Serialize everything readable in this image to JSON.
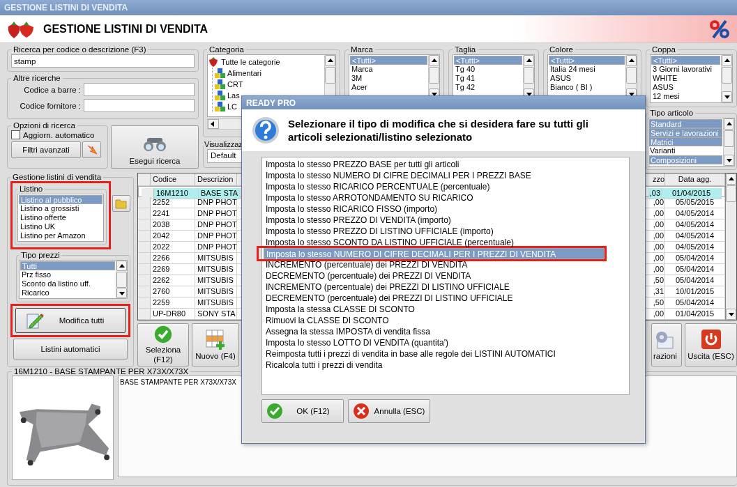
{
  "window": {
    "title": "GESTIONE LISTINI DI VENDITA"
  },
  "header": {
    "title": "GESTIONE LISTINI DI VENDITA"
  },
  "search": {
    "label": "Ricerca per codice o descrizione (F3)",
    "value": "stamp"
  },
  "other_searches": {
    "label": "Altre ricerche",
    "fields": [
      {
        "label": "Codice a barre :"
      },
      {
        "label": "Codice fornitore :"
      }
    ]
  },
  "search_options": {
    "label": "Opzioni di ricerca",
    "auto_update": {
      "label": "Aggiorn. automatico",
      "checked": false
    },
    "advanced_filters": "Filtri avanzati"
  },
  "run_search": "Esegui ricerca",
  "category": {
    "label": "Categoria",
    "tree": [
      {
        "label": "Tutte le categorie",
        "children": [
          {
            "label": "Alimentari"
          },
          {
            "label": "CRT"
          },
          {
            "label": "Las"
          },
          {
            "label": "LC"
          }
        ]
      }
    ]
  },
  "view": {
    "label": "Visualizzaz",
    "value": "Default"
  },
  "filters": [
    {
      "label": "Marca",
      "items": [
        {
          "label": "<Tutti>",
          "selected": true
        },
        {
          "label": "Marca",
          "selected": false
        },
        {
          "label": "3M",
          "selected": false
        },
        {
          "label": "Acer",
          "selected": false
        }
      ]
    },
    {
      "label": "Taglia",
      "items": [
        {
          "label": "<Tutti>",
          "selected": true
        },
        {
          "label": "Tg 40",
          "selected": false
        },
        {
          "label": "Tg 41",
          "selected": false
        },
        {
          "label": "Tg 42",
          "selected": false
        }
      ]
    },
    {
      "label": "Colore",
      "items": [
        {
          "label": "<Tutti>",
          "selected": true
        },
        {
          "label": "Italia 24 mesi",
          "selected": false
        },
        {
          "label": "ASUS",
          "selected": false
        },
        {
          "label": "Bianco ( BI )",
          "selected": false
        }
      ]
    },
    {
      "label": "Coppa",
      "items": [
        {
          "label": "<Tutti>",
          "selected": true
        },
        {
          "label": "3 Giorni lavorativi",
          "selected": false
        },
        {
          "label": "WHITE",
          "selected": false
        },
        {
          "label": "ASUS",
          "selected": false
        },
        {
          "label": "12 mesi",
          "selected": false
        }
      ]
    }
  ],
  "article_type": {
    "label": "Tipo articolo",
    "items": [
      {
        "label": "Standard",
        "selected": true
      },
      {
        "label": "Servizi e lavorazioni",
        "selected": true
      },
      {
        "label": "Matrici",
        "selected": true
      },
      {
        "label": "Varianti",
        "selected": false
      },
      {
        "label": "Composizioni",
        "selected": true
      }
    ]
  },
  "price_lists": {
    "label": "Gestione listini di vendita",
    "listino": {
      "label": "Listino",
      "highlighted": true,
      "items": [
        {
          "label": "Listino al pubblico",
          "selected": true
        },
        {
          "label": "Listino a grossisti",
          "selected": false
        },
        {
          "label": "Listino offerte",
          "selected": false
        },
        {
          "label": "Listino UK",
          "selected": false
        },
        {
          "label": "Listino per Amazon",
          "selected": false
        }
      ]
    },
    "price_type": {
      "label": "Tipo prezzi",
      "items": [
        {
          "label": "Tutti",
          "selected": true
        },
        {
          "label": "Prz fisso",
          "selected": false
        },
        {
          "label": "Sconto da listino uff.",
          "selected": false
        },
        {
          "label": "Ricarico",
          "selected": false
        }
      ]
    },
    "modify_all": {
      "label": "Modifica tutti",
      "highlighted": true
    },
    "auto_lists": "Listini automatici"
  },
  "table": {
    "columns": [
      "Codice",
      "Descrizion",
      "zzo",
      "Data agg."
    ],
    "rows": [
      {
        "cells": [
          "16M1210",
          "BASE STA",
          ",03",
          "01/04/2015"
        ],
        "selected": true
      },
      {
        "cells": [
          "2252",
          "DNP PHOT",
          ",00",
          "05/05/2015"
        ],
        "selected": false
      },
      {
        "cells": [
          "2241",
          "DNP PHOT",
          ",00",
          "04/05/2014"
        ],
        "selected": false
      },
      {
        "cells": [
          "2038",
          "DNP PHOT",
          ",00",
          "04/05/2014"
        ],
        "selected": false
      },
      {
        "cells": [
          "2042",
          "DNP PHOT",
          ",00",
          "04/05/2014"
        ],
        "selected": false
      },
      {
        "cells": [
          "2022",
          "DNP PHOT",
          ",00",
          "04/05/2014"
        ],
        "selected": false
      },
      {
        "cells": [
          "2266",
          "MITSUBIS",
          ",00",
          "05/04/2014"
        ],
        "selected": false
      },
      {
        "cells": [
          "2269",
          "MITSUBIS",
          ",00",
          "05/04/2014"
        ],
        "selected": false
      },
      {
        "cells": [
          "2262",
          "MITSUBIS",
          ",50",
          "05/04/2014"
        ],
        "selected": false
      },
      {
        "cells": [
          "2760",
          "MITSUBIS",
          ",31",
          "10/01/2015"
        ],
        "selected": false
      },
      {
        "cells": [
          "2259",
          "MITSUBIS",
          ",50",
          "05/04/2014"
        ],
        "selected": false
      },
      {
        "cells": [
          "UP-DR80",
          "SONY STA",
          ",00",
          "01/04/2015"
        ],
        "selected": false
      }
    ]
  },
  "actions": [
    {
      "kind": "select",
      "label": "Seleziona (F12)"
    },
    {
      "kind": "new",
      "label": "Nuovo (F4)"
    },
    {
      "kind": "settings",
      "label": "razioni"
    },
    {
      "kind": "exit",
      "label": "Uscita (ESC)"
    }
  ],
  "detail": {
    "title": "16M1210 - BASE STAMPANTE PER X73X/X73X",
    "description": "BASE STAMPANTE PER X73X/X73X"
  },
  "dialog": {
    "title": "READY PRO",
    "message": "Selezionare il tipo di modifica che si desidera fare su tutti gli articoli selezionati/listino selezionato",
    "options": [
      {
        "label": "Imposta lo stesso PREZZO BASE per tutti gli articoli",
        "selected": false,
        "highlighted": false
      },
      {
        "label": "Imposta lo stesso NUMERO DI CIFRE DECIMALI PER I PREZZI BASE",
        "selected": false,
        "highlighted": false
      },
      {
        "label": "Imposta lo stesso RICARICO PERCENTUALE (percentuale)",
        "selected": false,
        "highlighted": false
      },
      {
        "label": "Imposta lo stesso ARROTONDAMENTO SU RICARICO",
        "selected": false,
        "highlighted": false
      },
      {
        "label": "Imposta lo stesso RICARICO FISSO (importo)",
        "selected": false,
        "highlighted": false
      },
      {
        "label": "Imposta lo stesso PREZZO DI VENDITA (importo)",
        "selected": false,
        "highlighted": false
      },
      {
        "label": "Imposta lo stesso PREZZO DI LISTINO UFFICIALE (importo)",
        "selected": false,
        "highlighted": false
      },
      {
        "label": "Imposta lo stesso SCONTO DA LISTINO UFFICIALE (percentuale)",
        "selected": false,
        "highlighted": false
      },
      {
        "label": "Imposta lo stesso NUMERO DI CIFRE DECIMALI PER I PREZZI DI VENDITA",
        "selected": true,
        "highlighted": true
      },
      {
        "label": "INCREMENTO (percentuale) dei PREZZI DI VENDITA",
        "selected": false,
        "highlighted": false
      },
      {
        "label": "DECREMENTO (percentuale) dei PREZZI DI VENDITA",
        "selected": false,
        "highlighted": false
      },
      {
        "label": "INCREMENTO (percentuale) dei PREZZI DI LISTINO UFFICIALE",
        "selected": false,
        "highlighted": false
      },
      {
        "label": "DECREMENTO (percentuale) dei PREZZI DI LISTINO UFFICIALE",
        "selected": false,
        "highlighted": false
      },
      {
        "label": "Imposta la stessa CLASSE DI SCONTO",
        "selected": false,
        "highlighted": false
      },
      {
        "label": "Rimuovi la CLASSE DI SCONTO",
        "selected": false,
        "highlighted": false
      },
      {
        "label": "Assegna la stessa IMPOSTA di vendita fissa",
        "selected": false,
        "highlighted": false
      },
      {
        "label": "Imposta lo stesso LOTTO DI VENDITA (quantita')",
        "selected": false,
        "highlighted": false
      },
      {
        "label": "Reimposta tutti i prezzi di vendita in base alle regole dei LISTINI AUTOMATICI",
        "selected": false,
        "highlighted": false
      },
      {
        "label": "Ricalcola tutti i prezzi di vendita",
        "selected": false,
        "highlighted": false
      }
    ],
    "buttons": [
      {
        "kind": "ok",
        "label": "OK (F12)"
      },
      {
        "kind": "cancel",
        "label": "Annulla (ESC)"
      }
    ]
  }
}
